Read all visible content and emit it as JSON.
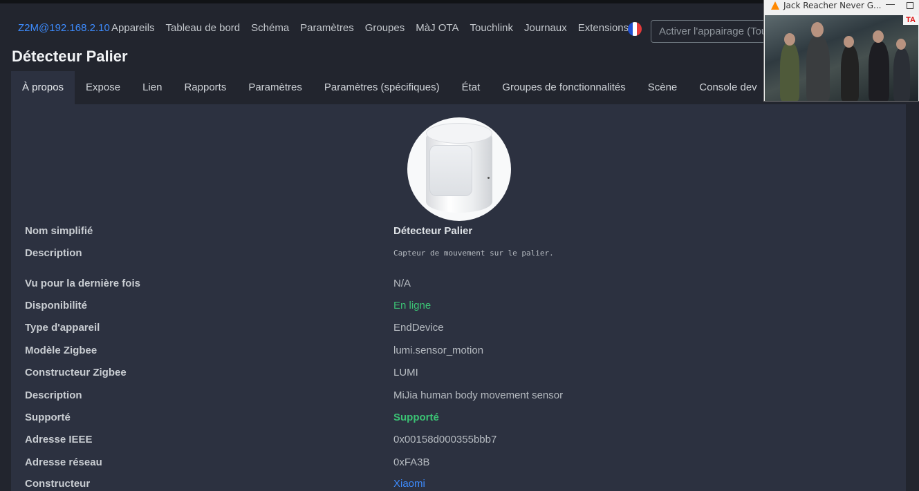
{
  "nav": {
    "brand": "Z2M@192.168.2.10",
    "links": [
      "Appareils",
      "Tableau de bord",
      "Schéma",
      "Paramètres",
      "Groupes",
      "MàJ OTA",
      "Touchlink",
      "Journaux",
      "Extensions"
    ],
    "language_flag": "flag-fr-icon",
    "pairing_placeholder": "Activer l'appairage (Tou"
  },
  "page": {
    "title": "Détecteur Palier"
  },
  "tabs": [
    "À propos",
    "Expose",
    "Lien",
    "Rapports",
    "Paramètres",
    "Paramètres (spécifiques)",
    "État",
    "Groupes de fonctionnalités",
    "Scène",
    "Console dev"
  ],
  "details": [
    {
      "label": "Nom simplifié",
      "value": "Détecteur Palier"
    },
    {
      "label": "Description",
      "value": "Capteur de mouvement sur le palier."
    },
    {
      "label": "Vu pour la dernière fois",
      "value": "N/A"
    },
    {
      "label": "Disponibilité",
      "value": "En ligne"
    },
    {
      "label": "Type d'appareil",
      "value": "EndDevice"
    },
    {
      "label": "Modèle Zigbee",
      "value": "lumi.sensor_motion"
    },
    {
      "label": "Constructeur Zigbee",
      "value": "LUMI"
    },
    {
      "label": "Description",
      "value": "MiJia human body movement sensor"
    },
    {
      "label": "Supporté",
      "value": "Supporté"
    },
    {
      "label": "Adresse IEEE",
      "value": "0x00158d000355bbb7"
    },
    {
      "label": "Adresse réseau",
      "value": "0xFA3B"
    },
    {
      "label": "Constructeur",
      "value": "Xiaomi"
    }
  ],
  "overlay": {
    "title": "Jack Reacher Never G...",
    "sign_text": "TA"
  },
  "colors": {
    "background": "#22252e",
    "panel": "#2c3140",
    "link": "#3d8bfd",
    "success": "#3bc274"
  }
}
